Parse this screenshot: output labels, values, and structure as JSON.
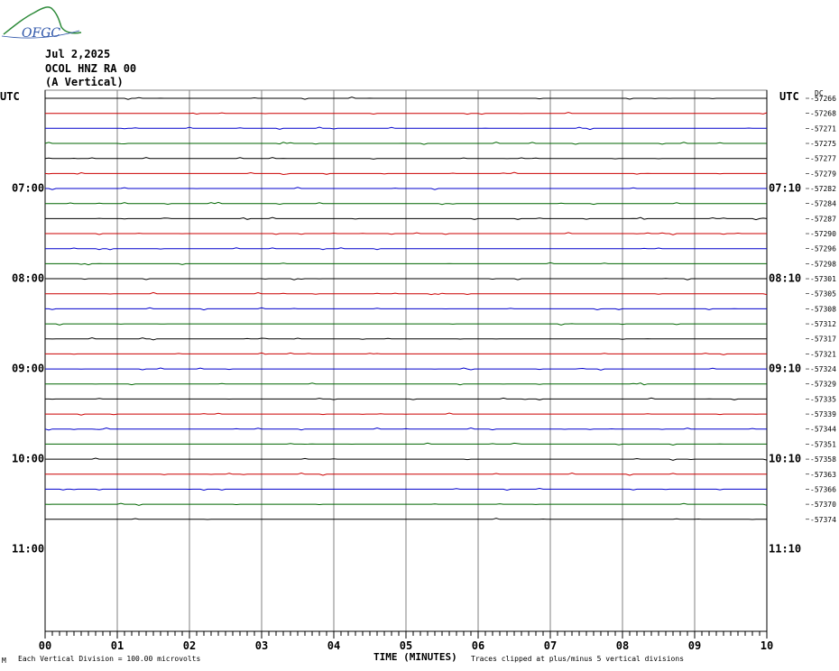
{
  "header": {
    "logo_text": "OFGC",
    "date": "Jul 2,2025",
    "station": "OCOL HNZ RA 00",
    "component": "(A Vertical)"
  },
  "left_axis_label": "UTC",
  "right_axis_label": "UTC",
  "dc_label": "DC",
  "footer": {
    "mark": "M",
    "division_note": "Each Vertical Division =  100.00 microvolts",
    "xlabel": "TIME (MINUTES)",
    "clip_note": "Traces clipped at plus/minus 5 vertical divisions"
  },
  "colors": {
    "black": "#000000",
    "red": "#cc0000",
    "blue": "#0000cc",
    "green": "#006600",
    "grid": "#808080",
    "logo_green": "#2e8b3a",
    "logo_blue": "#2b53a8"
  },
  "chart_data": {
    "type": "line",
    "title": "",
    "xlabel": "TIME (MINUTES)",
    "x_ticks": [
      "00",
      "01",
      "02",
      "03",
      "04",
      "05",
      "06",
      "07",
      "08",
      "09",
      "10"
    ],
    "xlim": [
      0,
      10
    ],
    "left_hour_labels": [
      "07:00",
      "08:00",
      "09:00",
      "10:00",
      "11:00"
    ],
    "right_hour_labels": [
      "07:10",
      "08:10",
      "09:10",
      "10:10",
      "11:10"
    ],
    "trace_colors_cycle": [
      "black",
      "red",
      "blue",
      "green"
    ],
    "trace_dc_offsets": [
      "-57266",
      "-57268",
      "-57271",
      "-57275",
      "-57277",
      "-57279",
      "-57282",
      "-57284",
      "-57287",
      "-57290",
      "-57296",
      "-57298",
      "-57301",
      "-57305",
      "-57308",
      "-57312",
      "-57317",
      "-57321",
      "-57324",
      "-57329",
      "-57335",
      "-57339",
      "-57344",
      "-57351",
      "-57358",
      "-57363",
      "-57366",
      "-57370",
      "-57374"
    ]
  }
}
